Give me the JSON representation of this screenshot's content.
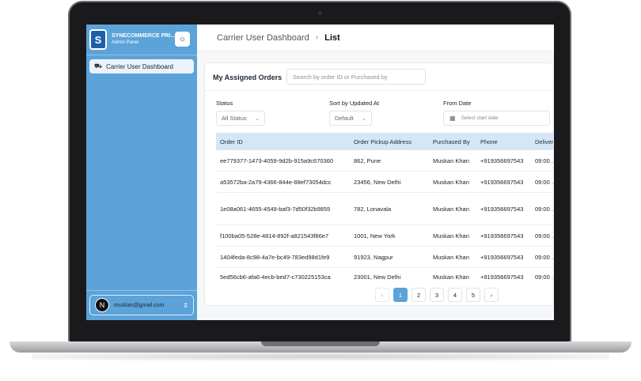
{
  "app": {
    "brand_name": "SYNECOMMERCE PRI...",
    "brand_sub": "Admin Panel",
    "logo_letter": "S",
    "accent_color": "#5ba3d9"
  },
  "sidebar": {
    "items": [
      {
        "label": "Carrier User Dashboard",
        "icon": "truck-icon"
      }
    ],
    "user": {
      "avatar_letter": "N",
      "email": "muskan@gmail.com"
    }
  },
  "breadcrumb": {
    "parent": "Carrier User Dashboard",
    "separator": "›",
    "current": "List"
  },
  "orders": {
    "title": "My Assigned Orders",
    "search_placeholder": "Search by order ID or Purchased by",
    "filters": {
      "status_label": "Status",
      "status_value": "All Status",
      "sort_label": "Sort by Updated At",
      "sort_value": "Default",
      "date_label": "From Date",
      "date_placeholder": "Select start date"
    },
    "columns": [
      "Order ID",
      "Order Pickup Address",
      "Purchased By",
      "Phone",
      "Deliver"
    ],
    "rows": [
      {
        "id": "ee779377-1473-4059-9d2b-915a9c670360",
        "address": "862, Pune",
        "by": "Muskan Khan",
        "phone": "+919356697543",
        "time": "09:00 ."
      },
      {
        "id": "a53572ba-2a79-4366-844e-88ef73054dcc",
        "address": "23456, New Delhi",
        "by": "Muskan Khan",
        "phone": "+919356697543",
        "time": "09:00 ."
      },
      {
        "id": "1e08a061-4655-4549-baf3-7d50f32b9855",
        "address": "782, Lonavala",
        "by": "Muskan Khan",
        "phone": "+919356697543",
        "time": "09:00 ."
      },
      {
        "id": "f100ba05-528e-4814-892f-a821543f86e7",
        "address": "1001, New York",
        "by": "Muskan Khan",
        "phone": "+919356697543",
        "time": "09:00 ."
      },
      {
        "id": "1404feda-8c98-4a7e-bc49-783ed98d1fe9",
        "address": "91923, Nagpur",
        "by": "Muskan Khan",
        "phone": "+919356697543",
        "time": "09:00 ."
      },
      {
        "id": "5ed56cb6-afa6-4ecb-bed7-c730225153ca",
        "address": "23001, New Delhi",
        "by": "Muskan Khan",
        "phone": "+919356697543",
        "time": "09:00 ."
      }
    ],
    "pagination": {
      "prev": "‹",
      "pages": [
        "1",
        "2",
        "3",
        "4",
        "5"
      ],
      "current": "1",
      "next": "›"
    }
  }
}
